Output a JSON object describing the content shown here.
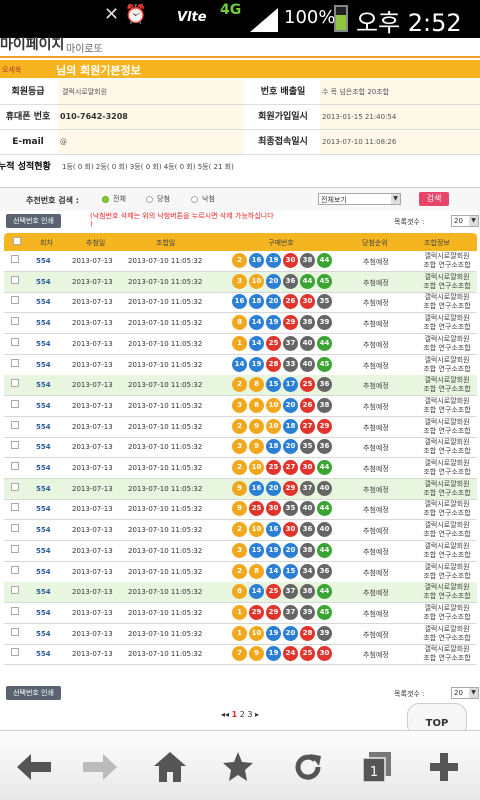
{
  "status_bar": {
    "lte": "Vlte",
    "net": "4G",
    "battery": "100%",
    "time": "오후 2:52"
  },
  "page": {
    "title": "마이페이지",
    "subtitle": "마이로또"
  },
  "section": {
    "small": "오세욱",
    "title": "님의 회원기본정보"
  },
  "member": {
    "grade_label": "회원등급",
    "grade_value": "갤럭시로얄회원",
    "sent_label": "번호 배출일",
    "sent_value": "수 목 넘은조합 20조합",
    "phone_label": "휴대폰 번호",
    "phone_value": "010-7642-3208",
    "join_label": "회원가입일시",
    "join_value": "2013-01-15 21:40:54",
    "email_label": "E-mail",
    "email_value": "@",
    "last_label": "최종접속일시",
    "last_value": "2013-07-10 11:08:26"
  },
  "stats": {
    "label": "누적 성적현황",
    "value": "1등( 0 회) 2등( 0 회) 3등( 0 회) 4등( 0 회) 5등( 21 회)"
  },
  "filter": {
    "label": "추천번호 검색 :",
    "opt_all": "전체",
    "opt_win": "당첨",
    "opt_lose": "낙첨",
    "select_value": "전체보기",
    "search_label": "검색"
  },
  "toolbar_top": {
    "print_label": "선택번호 인쇄",
    "notice_line1": "(낙첨번호 삭제는 위의 낙첨버튼을 누르시면 삭제 가능하십니다",
    "notice_line2": ")",
    "count_label": "목록갯수 :",
    "count_value": "20"
  },
  "toolbar_bottom": {
    "print_label": "선택번호 인쇄",
    "count_label": "목록갯수 :",
    "count_value": "20"
  },
  "table": {
    "headers": [
      "회차",
      "추첨일",
      "조합일",
      "구매번호",
      "당첨순위",
      "조합정보"
    ]
  },
  "rows": [
    {
      "num": "554",
      "draw": "2013-07-13",
      "combo": "2013-07-10 11:05:32",
      "balls": [
        2,
        16,
        19,
        30,
        38,
        44
      ],
      "status": "추첨예정",
      "info1": "갤럭시로얄회원",
      "info2": "조합 연구소조합"
    },
    {
      "num": "554",
      "draw": "2013-07-13",
      "combo": "2013-07-10 11:05:32",
      "balls": [
        3,
        10,
        20,
        36,
        44,
        45
      ],
      "status": "추첨예정",
      "info1": "갤럭시로얄회원",
      "info2": "조합 연구소조합"
    },
    {
      "num": "554",
      "draw": "2013-07-13",
      "combo": "2013-07-10 11:05:32",
      "balls": [
        16,
        18,
        20,
        26,
        30,
        35
      ],
      "status": "추첨예정",
      "info1": "갤럭시로얄회원",
      "info2": "조합 연구소조합"
    },
    {
      "num": "554",
      "draw": "2013-07-13",
      "combo": "2013-07-10 11:05:32",
      "balls": [
        8,
        14,
        19,
        29,
        38,
        39
      ],
      "status": "추첨예정",
      "info1": "갤럭시로얄회원",
      "info2": "조합 연구소조합"
    },
    {
      "num": "554",
      "draw": "2013-07-13",
      "combo": "2013-07-10 11:05:32",
      "balls": [
        1,
        14,
        25,
        37,
        40,
        44
      ],
      "status": "추첨예정",
      "info1": "갤럭시로얄회원",
      "info2": "조합 연구소조합"
    },
    {
      "num": "554",
      "draw": "2013-07-13",
      "combo": "2013-07-10 11:05:32",
      "balls": [
        14,
        19,
        28,
        33,
        40,
        45
      ],
      "status": "추첨예정",
      "info1": "갤럭시로얄회원",
      "info2": "조합 연구소조합"
    },
    {
      "num": "554",
      "draw": "2013-07-13",
      "combo": "2013-07-10 11:05:32",
      "balls": [
        2,
        8,
        15,
        17,
        25,
        36
      ],
      "status": "추첨예정",
      "info1": "갤럭시로얄회원",
      "info2": "조합 연구소조합"
    },
    {
      "num": "554",
      "draw": "2013-07-13",
      "combo": "2013-07-10 11:05:32",
      "balls": [
        3,
        8,
        10,
        20,
        26,
        38
      ],
      "status": "추첨예정",
      "info1": "갤럭시로얄회원",
      "info2": "조합 연구소조합"
    },
    {
      "num": "554",
      "draw": "2013-07-13",
      "combo": "2013-07-10 11:05:32",
      "balls": [
        2,
        9,
        10,
        18,
        27,
        29
      ],
      "status": "추첨예정",
      "info1": "갤럭시로얄회원",
      "info2": "조합 연구소조합"
    },
    {
      "num": "554",
      "draw": "2013-07-13",
      "combo": "2013-07-10 11:05:32",
      "balls": [
        3,
        9,
        18,
        20,
        35,
        36
      ],
      "status": "추첨예정",
      "info1": "갤럭시로얄회원",
      "info2": "조합 연구소조합"
    },
    {
      "num": "554",
      "draw": "2013-07-13",
      "combo": "2013-07-10 11:05:32",
      "balls": [
        2,
        10,
        25,
        27,
        30,
        44
      ],
      "status": "추첨예정",
      "info1": "갤럭시로얄회원",
      "info2": "조합 연구소조합"
    },
    {
      "num": "554",
      "draw": "2013-07-13",
      "combo": "2013-07-10 11:05:32",
      "balls": [
        9,
        16,
        20,
        29,
        37,
        40
      ],
      "status": "추첨예정",
      "info1": "갤럭시로얄회원",
      "info2": "조합 연구소조합"
    },
    {
      "num": "554",
      "draw": "2013-07-13",
      "combo": "2013-07-10 11:05:32",
      "balls": [
        9,
        25,
        30,
        35,
        40,
        44
      ],
      "status": "추첨예정",
      "info1": "갤럭시로얄회원",
      "info2": "조합 연구소조합"
    },
    {
      "num": "554",
      "draw": "2013-07-13",
      "combo": "2013-07-10 11:05:32",
      "balls": [
        2,
        10,
        16,
        30,
        36,
        40
      ],
      "status": "추첨예정",
      "info1": "갤럭시로얄회원",
      "info2": "조합 연구소조합"
    },
    {
      "num": "554",
      "draw": "2013-07-13",
      "combo": "2013-07-10 11:05:32",
      "balls": [
        3,
        15,
        19,
        20,
        38,
        44
      ],
      "status": "추첨예정",
      "info1": "갤럭시로얄회원",
      "info2": "조합 연구소조합"
    },
    {
      "num": "554",
      "draw": "2013-07-13",
      "combo": "2013-07-10 11:05:32",
      "balls": [
        2,
        8,
        14,
        15,
        34,
        36
      ],
      "status": "추첨예정",
      "info1": "갤럭시로얄회원",
      "info2": "조합 연구소조합"
    },
    {
      "num": "554",
      "draw": "2013-07-13",
      "combo": "2013-07-10 11:05:32",
      "balls": [
        8,
        14,
        25,
        37,
        38,
        44
      ],
      "status": "추첨예정",
      "info1": "갤럭시로얄회원",
      "info2": "조합 연구소조합"
    },
    {
      "num": "554",
      "draw": "2013-07-13",
      "combo": "2013-07-10 11:05:32",
      "balls": [
        1,
        29,
        29,
        37,
        39,
        45
      ],
      "status": "추첨예정",
      "info1": "갤럭시로얄회원",
      "info2": "조합 연구소조합"
    },
    {
      "num": "554",
      "draw": "2013-07-13",
      "combo": "2013-07-10 11:05:32",
      "balls": [
        1,
        10,
        19,
        20,
        28,
        39
      ],
      "status": "추첨예정",
      "info1": "갤럭시로얄회원",
      "info2": "조합 연구소조합"
    },
    {
      "num": "554",
      "draw": "2013-07-13",
      "combo": "2013-07-10 11:05:32",
      "balls": [
        7,
        9,
        19,
        24,
        25,
        30
      ],
      "status": "추첨예정",
      "info1": "갤럭시로얄회원",
      "info2": "조합 연구소조합"
    }
  ],
  "pager": {
    "prev": "◂◂",
    "current": "1",
    "p2": "2",
    "p3": "3",
    "next": "▸"
  },
  "top_button": "TOP",
  "ball_colors": {
    "yellow": "#f2a81d",
    "blue": "#2b7fd4",
    "red": "#e0342c",
    "gray": "#666666",
    "green": "#3aa532"
  },
  "nav_icons": [
    "back-icon",
    "forward-icon",
    "home-icon",
    "bookmark-icon",
    "refresh-icon",
    "tabs-icon",
    "add-icon"
  ],
  "colors": {
    "accent": "#f7b421",
    "row_alt": "#e8f6df",
    "search_btn": "#e8456a"
  }
}
